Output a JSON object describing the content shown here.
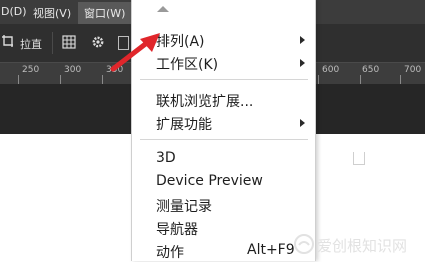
{
  "menubar": {
    "items": [
      "D(D)",
      "视图(V)",
      "窗口(W)"
    ]
  },
  "options_bar": {
    "straighten": "拉直"
  },
  "ruler": {
    "labels": [
      "250",
      "300",
      "350",
      "600",
      "650",
      "700"
    ]
  },
  "menu": {
    "items": [
      {
        "label": "排列(A)",
        "submenu": true
      },
      {
        "label": "工作区(K)",
        "submenu": true
      },
      {
        "label": "联机浏览扩展..."
      },
      {
        "label": "扩展功能",
        "submenu": true
      },
      {
        "label": "3D"
      },
      {
        "label": "Device Preview"
      },
      {
        "label": "测量记录"
      },
      {
        "label": "导航器"
      },
      {
        "label": "动作",
        "shortcut": "Alt+F9"
      }
    ]
  },
  "watermark": {
    "text": "爱创根知识网"
  },
  "colors": {
    "menubar_bg": "#3c3c3c",
    "canvas_dark": "#262626",
    "annotation_arrow": "#e0262b"
  }
}
